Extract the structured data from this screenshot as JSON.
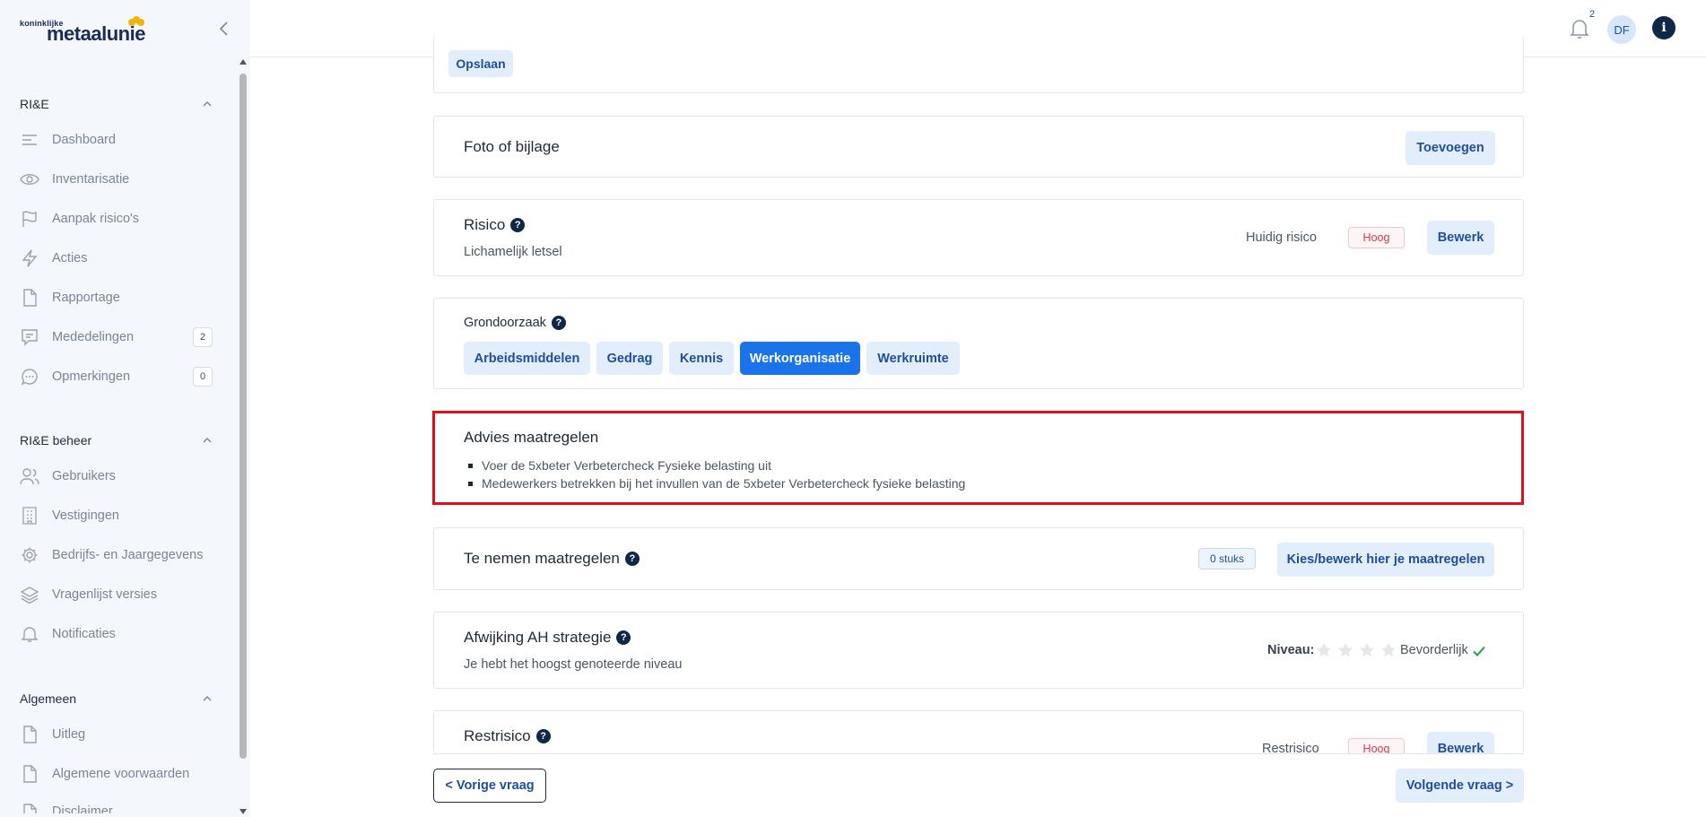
{
  "brand": {
    "small": "koninklijke",
    "name": "metaalunie"
  },
  "sidebar": {
    "sections": [
      {
        "title": "RI&E",
        "items": [
          {
            "label": "Dashboard",
            "icon": "menu-lines-icon"
          },
          {
            "label": "Inventarisatie",
            "icon": "eye-icon"
          },
          {
            "label": "Aanpak risico's",
            "icon": "flag-icon"
          },
          {
            "label": "Acties",
            "icon": "lightning-icon"
          },
          {
            "label": "Rapportage",
            "icon": "document-icon"
          },
          {
            "label": "Mededelingen",
            "icon": "message-icon",
            "count": "2"
          },
          {
            "label": "Opmerkingen",
            "icon": "chat-icon",
            "count": "0"
          }
        ]
      },
      {
        "title": "RI&E beheer",
        "items": [
          {
            "label": "Gebruikers",
            "icon": "users-icon"
          },
          {
            "label": "Vestigingen",
            "icon": "building-icon"
          },
          {
            "label": "Bedrijfs- en Jaargegevens",
            "icon": "gear-icon"
          },
          {
            "label": "Vragenlijst versies",
            "icon": "layers-icon"
          },
          {
            "label": "Notificaties",
            "icon": "bell-icon"
          }
        ]
      },
      {
        "title": "Algemeen",
        "items": [
          {
            "label": "Uitleg",
            "icon": "document-icon"
          },
          {
            "label": "Algemene voorwaarden",
            "icon": "document-icon"
          },
          {
            "label": "Disclaimer",
            "icon": "document-icon"
          }
        ]
      }
    ]
  },
  "header": {
    "notifications_count": "2",
    "avatar_initials": "DF",
    "info_label": "i"
  },
  "main": {
    "save_button": "Opslaan",
    "foto": {
      "title": "Foto of bijlage",
      "button": "Toevoegen"
    },
    "risico": {
      "title": "Risico",
      "subtitle": "Lichamelijk letsel",
      "current_label": "Huidig risico",
      "level": "Hoog",
      "button": "Bewerk"
    },
    "grondoorzaak": {
      "title": "Grondoorzaak",
      "options": [
        "Arbeidsmiddelen",
        "Gedrag",
        "Kennis",
        "Werkorganisatie",
        "Werkruimte"
      ],
      "selected": "Werkorganisatie"
    },
    "advies": {
      "title": "Advies maatregelen",
      "items": [
        "Voer de 5xbeter Verbetercheck Fysieke belasting uit",
        "Medewerkers betrekken bij het invullen van de 5xbeter Verbetercheck fysieke belasting"
      ]
    },
    "te_nemen": {
      "title": "Te nemen maatregelen",
      "count": "0 stuks",
      "button": "Kies/bewerk hier je maatregelen"
    },
    "afwijking": {
      "title": "Afwijking AH strategie",
      "subtitle": "Je hebt het hoogst genoteerde niveau",
      "niveau_label": "Niveau:",
      "stars_filled": 0,
      "stars_total": 4,
      "niveau_value": "Bevorderlijk"
    },
    "restrisico": {
      "title": "Restrisico",
      "label": "Restrisico",
      "level": "Hoog",
      "button": "Bewerk"
    }
  },
  "footer": {
    "prev": "< Vorige vraag",
    "next": "Volgende vraag >"
  },
  "colors": {
    "accent": "#1a73e8",
    "navy": "#0f2847",
    "danger": "#e00f1b",
    "check": "#22a447"
  }
}
